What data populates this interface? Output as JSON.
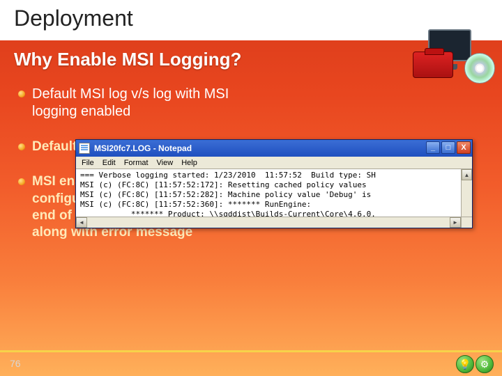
{
  "title": "Deployment",
  "subtitle": "Why Enable MSI Logging?",
  "bullets": {
    "b1": "Default MSI log v/s log with MSI logging enabled",
    "b2": "Default only … and i…",
    "b3": "MSI enabled log captures configuration details, start and end of each custom action, along with error message"
  },
  "notepad": {
    "title": "MSI20fc7.LOG - Notepad",
    "menu": [
      "File",
      "Edit",
      "Format",
      "View",
      "Help"
    ],
    "lines": [
      "=== Verbose logging started: 1/23/2010  11:57:52  Build type: SH",
      "MSI (c) (FC:8C) [11:57:52:172]: Resetting cached policy values",
      "MSI (c) (FC:8C) [11:57:52:282]: Machine policy value 'Debug' is",
      "MSI (c) (FC:8C) [11:57:52:360]: ******* RunEngine:",
      "           ******* Product: \\\\sgddist\\Builds-Current\\Core\\4.6.0."
    ],
    "buttons": {
      "min": "_",
      "max": "□",
      "close": "X"
    }
  },
  "page_number": "76",
  "foot_icons": {
    "a": "💡",
    "b": "⚙"
  }
}
